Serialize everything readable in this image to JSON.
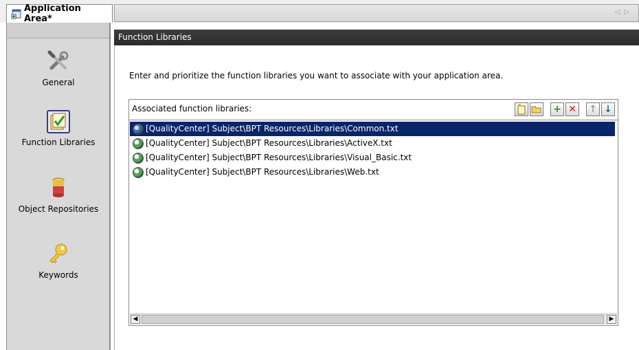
{
  "tab": {
    "title": "Application Area*"
  },
  "tabstrip": {
    "scroll_left": "◁",
    "scroll_right": "▷"
  },
  "nav": {
    "items": [
      {
        "label": "General",
        "icon": "tools-icon"
      },
      {
        "label": "Function Libraries",
        "icon": "function-library-icon",
        "selected": true
      },
      {
        "label": "Object Repositories",
        "icon": "object-repository-icon"
      },
      {
        "label": "Keywords",
        "icon": "key-icon"
      }
    ]
  },
  "content": {
    "header": "Function Libraries",
    "instruction": "Enter and prioritize the function libraries you want to associate with your application area.",
    "panel_title": "Associated function libraries:",
    "toolbar": [
      {
        "name": "new-library",
        "icon": "new-file-icon"
      },
      {
        "name": "open-library",
        "icon": "folder-icon"
      },
      {
        "name": "add",
        "icon": "plus-icon"
      },
      {
        "name": "remove",
        "icon": "delete-icon"
      },
      {
        "name": "move-up",
        "icon": "arrow-up-icon"
      },
      {
        "name": "move-down",
        "icon": "arrow-down-icon"
      }
    ],
    "libraries": [
      "[QualityCenter] Subject\\BPT Resources\\Libraries\\Common.txt",
      "[QualityCenter] Subject\\BPT Resources\\Libraries\\ActiveX.txt",
      "[QualityCenter] Subject\\BPT Resources\\Libraries\\Visual_Basic.txt",
      "[QualityCenter] Subject\\BPT Resources\\Libraries\\Web.txt"
    ],
    "selected_index": 0
  },
  "colors": {
    "selection": "#0a246a",
    "header_bg": "#333333"
  }
}
